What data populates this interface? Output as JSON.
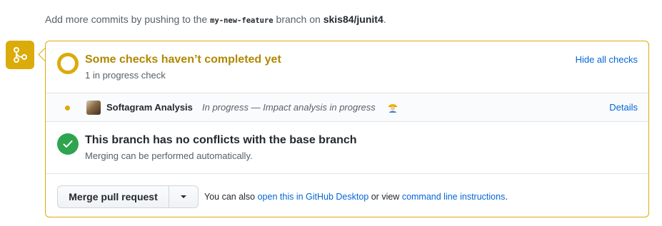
{
  "intro": {
    "prefix": "Add more commits by pushing to the",
    "branch": "my-new-feature",
    "middle": "branch on",
    "repo": "skis84/junit4",
    "suffix": "."
  },
  "checks": {
    "title": "Some checks haven’t completed yet",
    "subtitle": "1 in progress check",
    "toggle_label": "Hide all checks",
    "runs": [
      {
        "app_name": "Softagram Analysis",
        "status": "In progress — Impact analysis in progress",
        "status_emoji": "construction-worker-icon",
        "details_label": "Details"
      }
    ]
  },
  "conflicts": {
    "title": "This branch has no conflicts with the base branch",
    "subtitle": "Merging can be performed automatically."
  },
  "merge": {
    "button_label": "Merge pull request",
    "hint_prefix": "You can also",
    "desktop_link": "open this in GitHub Desktop",
    "hint_middle": "or view",
    "cli_link": "command line instructions",
    "hint_suffix": "."
  },
  "colors": {
    "pending": "#dbab09",
    "pending_text": "#b08800",
    "success": "#2ea44f",
    "link": "#0366d6"
  }
}
